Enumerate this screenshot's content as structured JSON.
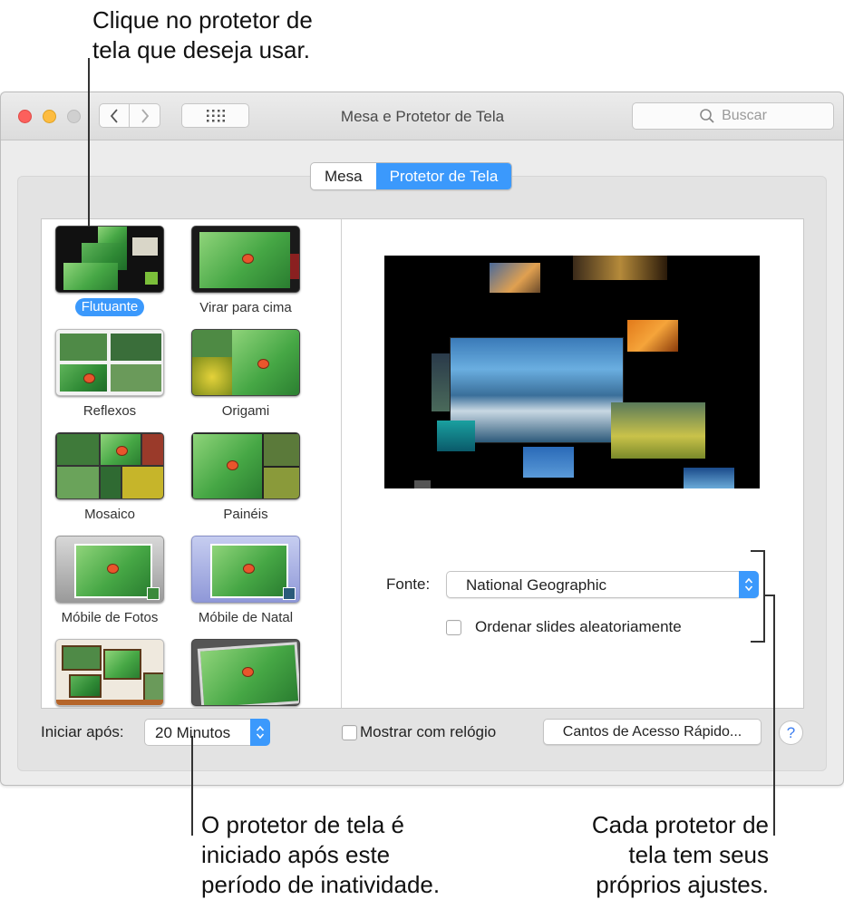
{
  "callouts": {
    "top": [
      "Clique no protetor de",
      "tela que deseja usar."
    ],
    "bottom_left": [
      "O protetor de tela é",
      "iniciado após este",
      "período de inatividade."
    ],
    "bottom_right": [
      "Cada protetor de",
      "tela tem seus",
      "próprios ajustes."
    ]
  },
  "window": {
    "title": "Mesa e Protetor de Tela",
    "search_placeholder": "Buscar"
  },
  "tabs": [
    {
      "label": "Mesa",
      "active": false
    },
    {
      "label": "Protetor de Tela",
      "active": true
    }
  ],
  "screensavers": [
    {
      "label": "Flutuante",
      "selected": true
    },
    {
      "label": "Virar para cima",
      "selected": false
    },
    {
      "label": "Reflexos",
      "selected": false
    },
    {
      "label": "Origami",
      "selected": false
    },
    {
      "label": "Mosaico",
      "selected": false
    },
    {
      "label": "Painéis",
      "selected": false
    },
    {
      "label": "Móbile de Fotos",
      "selected": false
    },
    {
      "label": "Móbile de Natal",
      "selected": false
    }
  ],
  "options": {
    "source_label": "Fonte:",
    "source_value": "National Geographic",
    "shuffle_label": "Ordenar slides aleatoriamente",
    "shuffle_checked": false
  },
  "bottom": {
    "start_label": "Iniciar após:",
    "start_value": "20 Minutos",
    "clock_label": "Mostrar com relógio",
    "clock_checked": false,
    "hot_corners_label": "Cantos de Acesso Rápido...",
    "help_label": "?"
  },
  "colors": {
    "accent": "#3b99fc"
  }
}
